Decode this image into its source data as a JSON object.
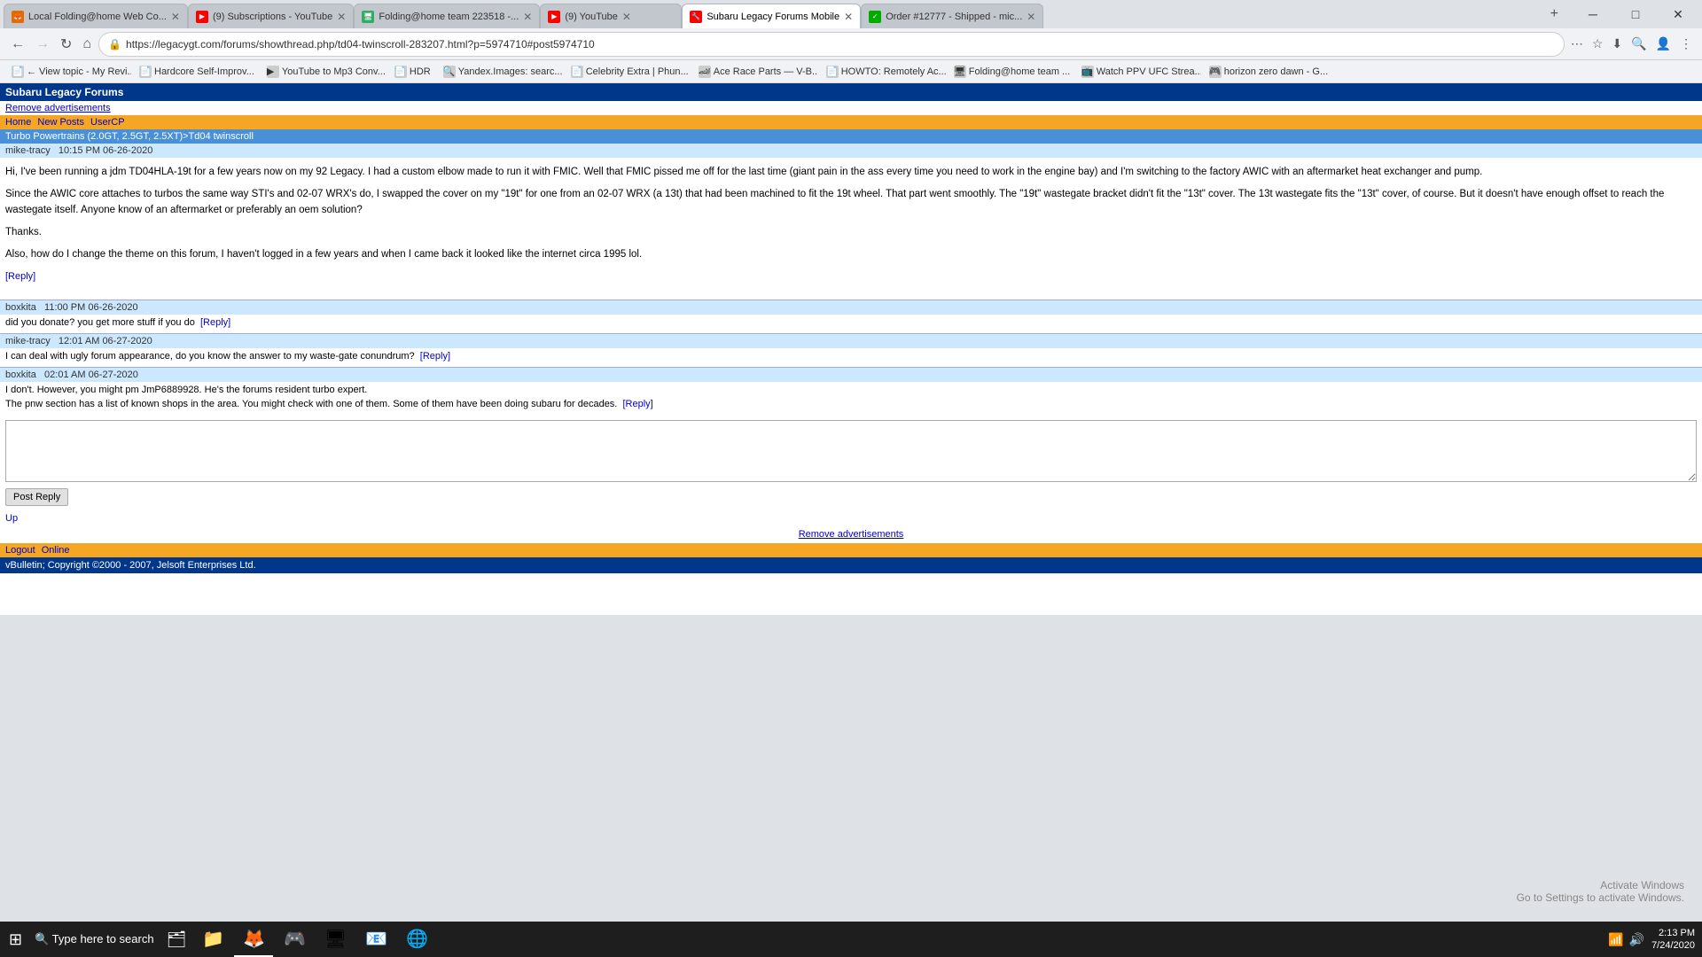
{
  "browser": {
    "tabs": [
      {
        "id": "t1",
        "label": "Local Folding@home Web Co...",
        "favicon": "🦊",
        "favicon_class": "ff",
        "active": false
      },
      {
        "id": "t2",
        "label": "(9) Subscriptions - YouTube",
        "favicon": "▶",
        "favicon_class": "yt",
        "active": false
      },
      {
        "id": "t3",
        "label": "Folding@home team 223518 -...",
        "favicon": "🖥",
        "favicon_class": "fold",
        "active": false
      },
      {
        "id": "t4",
        "label": "(9) YouTube",
        "favicon": "▶",
        "favicon_class": "yt",
        "active": false
      },
      {
        "id": "t5",
        "label": "Subaru Legacy Forums Mobile",
        "favicon": "🔧",
        "favicon_class": "sub",
        "active": true
      },
      {
        "id": "t6",
        "label": "Order #12777 - Shipped - mic...",
        "favicon": "✓",
        "favicon_class": "order",
        "active": false
      }
    ],
    "url": "https://legacygt.com/forums/showthread.php/td04-twinscroll-283207.html?p=5974710#post5974710",
    "window_controls": [
      "─",
      "□",
      "✕"
    ]
  },
  "bookmarks": [
    {
      "label": "← View topic - My Revi...",
      "favicon": "📄"
    },
    {
      "label": "Hardcore Self-Improv...",
      "favicon": "📄"
    },
    {
      "label": "YouTube to Mp3 Conv...",
      "favicon": "▶"
    },
    {
      "label": "HDR",
      "favicon": "📄"
    },
    {
      "label": "Yandex.Images: searc...",
      "favicon": "🔍"
    },
    {
      "label": "Celebrity Extra | Phun...",
      "favicon": "📄"
    },
    {
      "label": "Ace Race Parts — V-B...",
      "favicon": "🏎"
    },
    {
      "label": "HOWTO: Remotely Ac...",
      "favicon": "📄"
    },
    {
      "label": "Folding@home team ...",
      "favicon": "🖥"
    },
    {
      "label": "Watch PPV UFC Strea...",
      "favicon": "📺"
    },
    {
      "label": "horizon zero dawn - G...",
      "favicon": "🎮"
    }
  ],
  "forum": {
    "site_name": "Subaru Legacy Forums",
    "remove_ads": "Remove advertisements",
    "nav": {
      "home": "Home",
      "new_posts": "New Posts",
      "user_cp": "UserCP"
    },
    "breadcrumb": "Turbo Powertrains (2.0GT, 2.5GT, 2.5XT)>Td04 twinscroll",
    "posts": [
      {
        "author": "mike-tracy",
        "timestamp": "10:15 PM 06-26-2020",
        "content_paragraphs": [
          "Hi, I've been running a jdm TD04HLA-19t for a few years now on my 92 Legacy. I had a custom elbow made to run it with FMIC. Well that FMIC pissed me off for the last time (giant pain in the ass every time you need to work in the engine bay) and I'm switching to the factory AWIC with an aftermarket heat exchanger and pump.",
          "Since the AWIC core attaches to turbos the same way STI's and 02-07 WRX's do, I swapped the cover on my \"19t\" for one from an 02-07 WRX (a 13t) that had been machined to fit the 19t wheel. That part went smoothly. The \"19t\" wastegate bracket didn't fit the \"13t\" cover. The 13t wastegate fits the \"13t\" cover, of course. But it doesn't have enough offset to reach the wastegate itself. Anyone know of an aftermarket or preferably an oem solution?",
          "Thanks.",
          "Also, how do I change the theme on this forum, I haven't logged in a few years and when I came back it looked like the internet circa 1995 lol."
        ]
      }
    ],
    "reply_link_main": "[Reply]",
    "comments": [
      {
        "author": "boxkita",
        "timestamp": "11:00 PM 06-26-2020",
        "text": "did you donate? you get more stuff if you do",
        "reply_link": "[Reply]"
      },
      {
        "author": "mike-tracy",
        "timestamp": "12:01 AM 06-27-2020",
        "text": "I can deal with ugly forum appearance, do you know the answer to my waste-gate conundrum?",
        "reply_link": "[Reply]"
      },
      {
        "author": "boxkita",
        "timestamp": "02:01 AM 06-27-2020",
        "text1": "I don't. However, you might pm JmP6889928. He's the forums resident turbo expert.",
        "text2": "The pnw section has a list of known shops in the area. You might check with one of them. Some of them have been doing subaru for decades.",
        "reply_link": "[Reply]"
      }
    ],
    "reply_form": {
      "placeholder": "",
      "submit_label": "Post Reply"
    },
    "up_link": "Up",
    "remove_ads_bottom": "Remove advertisements",
    "footer": {
      "logout": "Logout",
      "online": "Online",
      "copyright": "vBulletin; Copyright ©2000 - 2007, Jelsoft Enterprises Ltd."
    }
  },
  "taskbar": {
    "apps": [
      {
        "icon": "⊞",
        "name": "start"
      },
      {
        "icon": "🔍",
        "name": "search"
      },
      {
        "icon": "🗂",
        "name": "task-view"
      },
      {
        "icon": "📁",
        "name": "file-explorer"
      },
      {
        "icon": "🦊",
        "name": "firefox"
      },
      {
        "icon": "🎮",
        "name": "game-app"
      },
      {
        "icon": "🖥",
        "name": "app5"
      },
      {
        "icon": "📧",
        "name": "app6"
      },
      {
        "icon": "🌐",
        "name": "edge"
      }
    ],
    "clock": {
      "time": "2:13 PM",
      "date": "7/24/2020"
    },
    "activate_windows": "Activate Windows",
    "activate_windows_sub": "Go to Settings to activate Windows."
  }
}
